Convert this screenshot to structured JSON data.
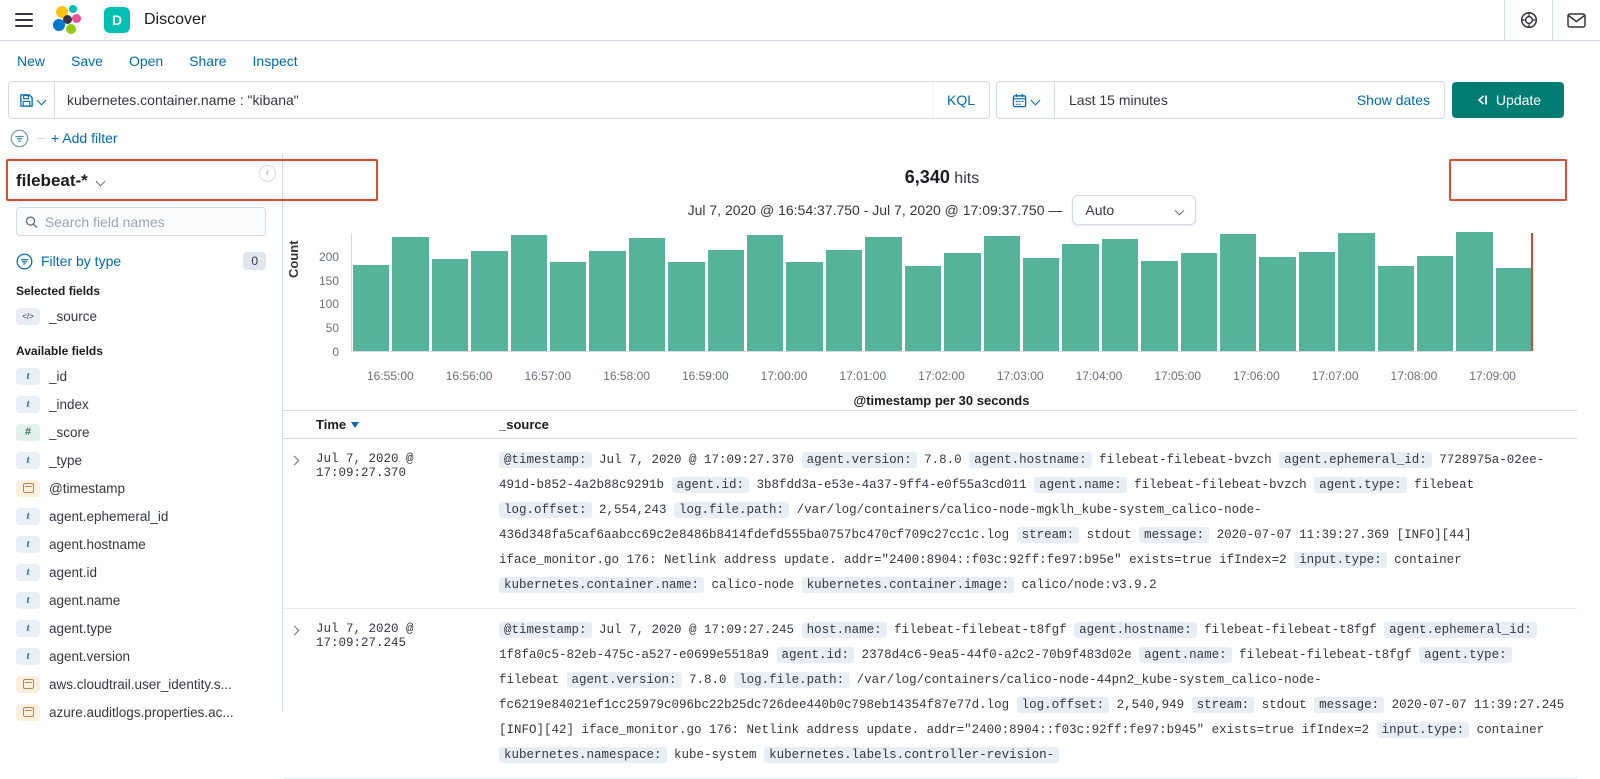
{
  "colors": {
    "accent_blue": "#006BB4",
    "bar_teal": "#54B399",
    "update_teal": "#017D73",
    "annotation": "#DE4E2E",
    "badge_teal": "#00BFB3",
    "time_marker": "#CC4B32"
  },
  "header": {
    "app_badge": "D",
    "title": "Discover"
  },
  "nav": {
    "items": [
      "New",
      "Save",
      "Open",
      "Share",
      "Inspect"
    ]
  },
  "query_bar": {
    "query": "kubernetes.container.name : \"kibana\"",
    "language_label": "KQL",
    "time_range": "Last 15 minutes",
    "show_dates_label": "Show dates",
    "update_label": "Update"
  },
  "filter_bar": {
    "add_filter_label": "+ Add filter"
  },
  "sidebar": {
    "index_pattern": "filebeat-*",
    "search_placeholder": "Search field names",
    "filter_by_type_label": "Filter by type",
    "filter_count": "0",
    "selected_heading": "Selected fields",
    "selected_fields": [
      {
        "name": "_source",
        "type": "source"
      }
    ],
    "available_heading": "Available fields",
    "available_fields": [
      {
        "name": "_id",
        "type": "string"
      },
      {
        "name": "_index",
        "type": "string"
      },
      {
        "name": "_score",
        "type": "number"
      },
      {
        "name": "_type",
        "type": "string"
      },
      {
        "name": "@timestamp",
        "type": "date"
      },
      {
        "name": "agent.ephemeral_id",
        "type": "string"
      },
      {
        "name": "agent.hostname",
        "type": "string"
      },
      {
        "name": "agent.id",
        "type": "string"
      },
      {
        "name": "agent.name",
        "type": "string"
      },
      {
        "name": "agent.type",
        "type": "string"
      },
      {
        "name": "agent.version",
        "type": "string"
      },
      {
        "name": "aws.cloudtrail.user_identity.s...",
        "type": "date"
      },
      {
        "name": "azure.auditlogs.properties.ac...",
        "type": "date"
      }
    ]
  },
  "hits": {
    "count": "6,340",
    "label": "hits",
    "range": "Jul 7, 2020 @ 16:54:37.750 - Jul 7, 2020 @ 17:09:37.750 —",
    "interval_label": "Auto"
  },
  "chart_data": {
    "type": "bar",
    "title": "6,340 hits",
    "xlabel": "@timestamp per 30 seconds",
    "ylabel": "Count",
    "x_tick_labels": [
      "16:55:00",
      "16:56:00",
      "16:57:00",
      "16:58:00",
      "16:59:00",
      "17:00:00",
      "17:01:00",
      "17:02:00",
      "17:03:00",
      "17:04:00",
      "17:05:00",
      "17:06:00",
      "17:07:00",
      "17:08:00",
      "17:09:00"
    ],
    "y_ticks": [
      0,
      50,
      100,
      150,
      200
    ],
    "ylim": [
      0,
      250
    ],
    "bucket_interval": "30 seconds",
    "values": [
      180,
      240,
      193,
      210,
      243,
      188,
      210,
      238,
      186,
      212,
      243,
      186,
      212,
      240,
      178,
      205,
      242,
      195,
      225,
      235,
      190,
      205,
      245,
      198,
      208,
      248,
      178,
      200,
      250,
      175
    ],
    "legend": false,
    "grid": false
  },
  "table": {
    "time_header": "Time",
    "source_header": "_source",
    "rows": [
      {
        "time": "Jul 7, 2020 @ 17:09:27.370",
        "tokens": [
          [
            "@timestamp",
            "Jul 7, 2020 @ 17:09:27.370"
          ],
          [
            "agent.version",
            "7.8.0"
          ],
          [
            "agent.hostname",
            "filebeat-filebeat-bvzch"
          ],
          [
            "agent.ephemeral_id",
            "7728975a-02ee-491d-b852-4a2b88c9291b"
          ],
          [
            "agent.id",
            "3b8fdd3a-e53e-4a37-9ff4-e0f55a3cd011"
          ],
          [
            "agent.name",
            "filebeat-filebeat-bvzch"
          ],
          [
            "agent.type",
            "filebeat"
          ],
          [
            "log.offset",
            "2,554,243"
          ],
          [
            "log.file.path",
            "/var/log/containers/calico-node-mgklh_kube-system_calico-node-436d348fa5caf6aabcc69c2e8486b8414fdefd555ba0757bc470cf709c27cc1c.log"
          ],
          [
            "stream",
            "stdout"
          ],
          [
            "message",
            "2020-07-07 11:39:27.369 [INFO][44] iface_monitor.go 176: Netlink address update. addr=\"2400:8904::f03c:92ff:fe97:b95e\" exists=true ifIndex=2"
          ],
          [
            "input.type",
            "container"
          ],
          [
            "kubernetes.container.name",
            "calico-node"
          ],
          [
            "kubernetes.container.image",
            "calico/node:v3.9.2"
          ]
        ]
      },
      {
        "time": "Jul 7, 2020 @ 17:09:27.245",
        "tokens": [
          [
            "@timestamp",
            "Jul 7, 2020 @ 17:09:27.245"
          ],
          [
            "host.name",
            "filebeat-filebeat-t8fgf"
          ],
          [
            "agent.hostname",
            "filebeat-filebeat-t8fgf"
          ],
          [
            "agent.ephemeral_id",
            "1f8fa0c5-82eb-475c-a527-e0699e5518a9"
          ],
          [
            "agent.id",
            "2378d4c6-9ea5-44f0-a2c2-70b9f483d02e"
          ],
          [
            "agent.name",
            "filebeat-filebeat-t8fgf"
          ],
          [
            "agent.type",
            "filebeat"
          ],
          [
            "agent.version",
            "7.8.0"
          ],
          [
            "log.file.path",
            "/var/log/containers/calico-node-44pn2_kube-system_calico-node-fc6219e84021ef1cc25979c096bc22b25dc726dee440b0c798eb14354f87e77d.log"
          ],
          [
            "log.offset",
            "2,540,949"
          ],
          [
            "stream",
            "stdout"
          ],
          [
            "message",
            "2020-07-07 11:39:27.245 [INFO][42] iface_monitor.go 176: Netlink address update. addr=\"2400:8904::f03c:92ff:fe97:b945\" exists=true ifIndex=2"
          ],
          [
            "input.type",
            "container"
          ],
          [
            "kubernetes.namespace",
            "kube-system"
          ],
          [
            "kubernetes.labels.controller-revision-",
            ""
          ]
        ]
      }
    ]
  }
}
